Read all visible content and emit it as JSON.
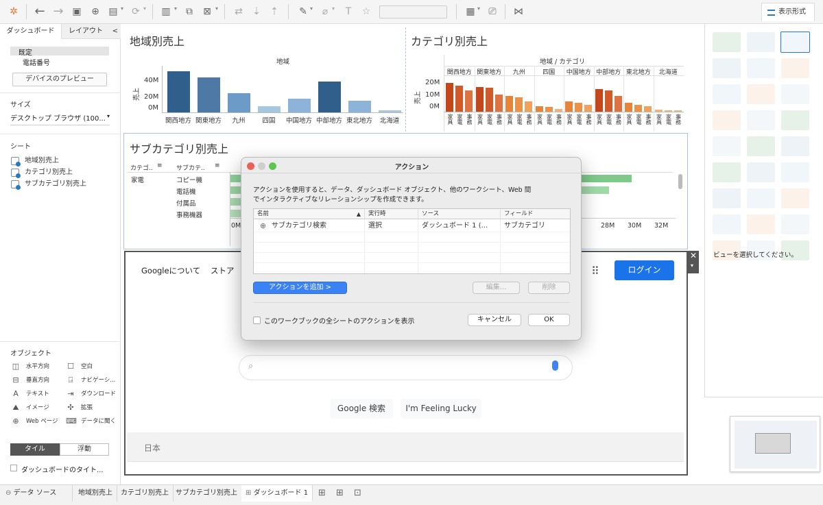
{
  "toolbar": {
    "showme_tab": "表示形式"
  },
  "left_panel": {
    "tabs": {
      "dashboard": "ダッシュボード",
      "layout": "レイアウト",
      "collapse": "<"
    },
    "device": {
      "default": "既定",
      "phone": "電話番号",
      "preview_button": "デバイスのプレビュー"
    },
    "size": {
      "heading": "サイズ",
      "value": "デスクトップ ブラウザ (100..."
    },
    "sheets": {
      "heading": "シート",
      "items": [
        "地域別売上",
        "カテゴリ別売上",
        "サブカテゴリ別売上"
      ]
    },
    "objects": {
      "heading": "オブジェクト",
      "items": [
        {
          "label": "水平方向",
          "icon": "horizontal-icon"
        },
        {
          "label": "空白",
          "icon": "blank-icon"
        },
        {
          "label": "垂直方向",
          "icon": "vertical-icon"
        },
        {
          "label": "ナビゲーシ...",
          "icon": "navigation-icon"
        },
        {
          "label": "テキスト",
          "icon": "text-icon"
        },
        {
          "label": "ダウンロード",
          "icon": "download-icon"
        },
        {
          "label": "イメージ",
          "icon": "image-icon"
        },
        {
          "label": "拡張",
          "icon": "extension-icon"
        },
        {
          "label": "Web ページ",
          "icon": "webpage-icon"
        },
        {
          "label": "データに聞く",
          "icon": "ask-data-icon"
        }
      ]
    },
    "mode": {
      "tiled": "タイル",
      "floating": "浮動"
    },
    "show_title": "ダッシュボードのタイト..."
  },
  "region_chart": {
    "title": "地域別売上",
    "header": "地域",
    "ylabel": "売上",
    "yticks": [
      "40M",
      "20M",
      "0M"
    ]
  },
  "category_chart": {
    "title": "カテゴリ別売上",
    "header": "地域 / カテゴリ",
    "ylabel": "売上",
    "yticks": [
      "20M",
      "10M",
      "0M"
    ],
    "cat_labels": [
      "家具",
      "家電",
      "事務"
    ]
  },
  "subcategory_chart": {
    "title": "サブカテゴリ別売上",
    "col1_header": "カテゴ..",
    "col2_header": "サブカテ..",
    "category": "家電",
    "subcategories": [
      "コピー機",
      "電話機",
      "付属品",
      "事務機器"
    ],
    "xticks_visible": [
      "0M",
      "28M",
      "30M",
      "32M"
    ]
  },
  "web_page": {
    "about_google": "Googleについて",
    "store": "ストア",
    "login_button": "ログイン",
    "search_button": "Google 検索",
    "lucky_button": "I'm Feeling Lucky",
    "footer_country": "日本"
  },
  "dialog": {
    "title": "アクション",
    "description_line1": "アクションを使用すると、データ、ダッシュボード オブジェクト、他のワークシート、Web 間",
    "description_line2": "でインタラクティブなリレーションシップを作成できます。",
    "columns": [
      "名前",
      "実行時",
      "ソース",
      "フィールド"
    ],
    "rows": [
      {
        "name": "サブカテゴリ検索",
        "run_on": "選択",
        "source": "ダッシュボード 1 (...",
        "field": "サブカテゴリ"
      }
    ],
    "add_action_button": "アクションを追加 >",
    "edit_button": "編集...",
    "delete_button": "削除",
    "show_all_checkbox": "このワークブックの全シートのアクションを表示",
    "cancel_button": "キャンセル",
    "ok_button": "OK"
  },
  "show_me": {
    "hint": "ビューを選択してください。"
  },
  "bottom_tabs": {
    "data_source": "データ ソース",
    "sheets": [
      "地域別売上",
      "カテゴリ別売上",
      "サブカテゴリ別売上"
    ],
    "dashboard": "ダッシュボード 1"
  },
  "colors": {
    "blue_dark": "#2f5f8a",
    "blue_mid": "#4e79a7",
    "blue_light": "#a7c6e0",
    "orange_dark": "#c4471c",
    "orange": "#e8843a",
    "orange_light": "#f3b27a",
    "green": "#7fc98b",
    "accent_blue": "#1a73e8"
  },
  "chart_data": [
    {
      "type": "bar",
      "title": "地域別売上",
      "xlabel": "地域",
      "ylabel": "売上",
      "categories": [
        "関西地方",
        "関東地方",
        "九州",
        "四国",
        "中国地方",
        "中部地方",
        "東北地方",
        "北海道"
      ],
      "values": [
        53,
        45,
        25,
        8,
        18,
        40,
        15,
        3
      ],
      "ylim": [
        0,
        60
      ],
      "unit": "M"
    },
    {
      "type": "bar",
      "title": "カテゴリ別売上",
      "xlabel": "地域 / カテゴリ",
      "ylabel": "売上",
      "groups": [
        "関西地方",
        "関東地方",
        "九州",
        "四国",
        "中国地方",
        "中部地方",
        "東北地方",
        "北海道"
      ],
      "categories": [
        "家具",
        "家電",
        "事務"
      ],
      "values": [
        [
          22,
          20,
          16
        ],
        [
          19,
          18,
          13
        ],
        [
          12,
          11,
          8
        ],
        [
          4,
          3.5,
          2
        ],
        [
          8,
          7,
          5
        ],
        [
          17,
          16,
          12
        ],
        [
          7,
          5,
          4
        ],
        [
          1.5,
          1.2,
          0.8
        ]
      ],
      "ylim": [
        0,
        25
      ],
      "unit": "M"
    },
    {
      "type": "bar",
      "title": "サブカテゴリ別売上",
      "orientation": "horizontal",
      "categories": [
        "コピー機",
        "電話機",
        "付属品",
        "事務機器"
      ],
      "values": [
        32,
        30,
        20,
        18
      ],
      "unit": "M"
    }
  ]
}
